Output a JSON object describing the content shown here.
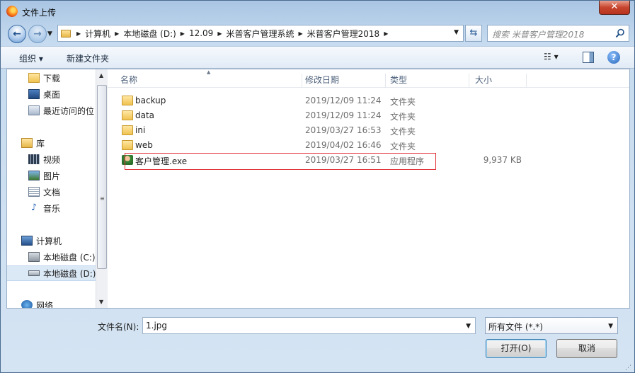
{
  "window": {
    "title": "文件上传",
    "close_glyph": "✕"
  },
  "address": {
    "breadcrumbs": [
      "计算机",
      "本地磁盘 (D:)",
      "12.09",
      "米普客户管理系统",
      "米普客户管理2018"
    ],
    "search_placeholder": "搜索 米普客户管理2018"
  },
  "toolbar": {
    "organize_label": "组织 ▾",
    "new_folder_label": "新建文件夹",
    "help_glyph": "?"
  },
  "nav": {
    "items": [
      {
        "label": "下载",
        "icon": "downloads-icon"
      },
      {
        "label": "桌面",
        "icon": "desktop-icon"
      },
      {
        "label": "最近访问的位",
        "icon": "recent-places-icon"
      },
      {
        "label": "库",
        "icon": "library-icon"
      },
      {
        "label": "视频",
        "icon": "videos-icon"
      },
      {
        "label": "图片",
        "icon": "pictures-icon"
      },
      {
        "label": "文档",
        "icon": "documents-icon"
      },
      {
        "label": "音乐",
        "icon": "music-icon"
      },
      {
        "label": "计算机",
        "icon": "computer-icon"
      },
      {
        "label": "本地磁盘 (C:)",
        "icon": "drive-c-icon"
      },
      {
        "label": "本地磁盘 (D:)",
        "icon": "drive-d-icon"
      },
      {
        "label": "网络",
        "icon": "network-icon"
      }
    ]
  },
  "columns": {
    "name": "名称",
    "date": "修改日期",
    "type": "类型",
    "size": "大小"
  },
  "files": [
    {
      "name": "backup",
      "date": "2019/12/09 11:24",
      "type": "文件夹",
      "size": ""
    },
    {
      "name": "data",
      "date": "2019/12/09 11:24",
      "type": "文件夹",
      "size": ""
    },
    {
      "name": "ini",
      "date": "2019/03/27 16:53",
      "type": "文件夹",
      "size": ""
    },
    {
      "name": "web",
      "date": "2019/04/02 16:46",
      "type": "文件夹",
      "size": ""
    },
    {
      "name": "客户管理.exe",
      "date": "2019/03/27 16:51",
      "type": "应用程序",
      "size": "9,937 KB"
    }
  ],
  "footer": {
    "filename_label": "文件名(N):",
    "filename_value": "1.jpg",
    "filetype_value": "所有文件 (*.*)",
    "open_label": "打开(O)",
    "cancel_label": "取消"
  },
  "colors": {
    "highlight_border": "#e0333a",
    "selected_nav_bg": "#dbe8f6"
  }
}
